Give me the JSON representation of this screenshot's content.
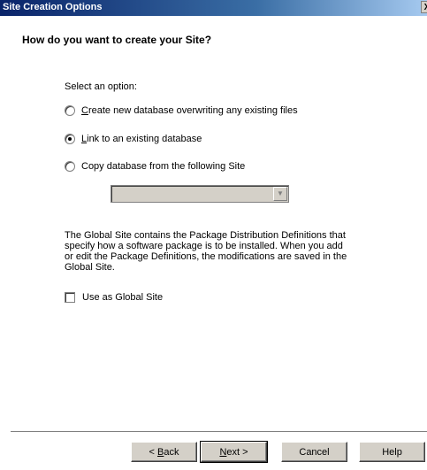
{
  "window": {
    "title": "Site Creation Options",
    "close_glyph": "X"
  },
  "heading": "How do you want to create your Site?",
  "prompt": "Select an option:",
  "options": [
    {
      "mnemonic": "C",
      "rest": "reate new database overwriting any existing files",
      "checked": false
    },
    {
      "mnemonic": "L",
      "rest": "ink to an existing database",
      "checked": true
    },
    {
      "mnemonic": "",
      "rest": "Copy database from the following Site",
      "checked": false
    }
  ],
  "site_combo": {
    "value": "",
    "arrow_icon": "chevron-down-icon"
  },
  "description": "The Global Site contains the Package Distribution Definitions that specify how a software package is to be installed. When you add or edit the Package Definitions, the modifications are saved in the Global Site.",
  "global_checkbox": {
    "label": "Use as Global Site",
    "checked": false
  },
  "buttons": {
    "back_prefix": "< ",
    "back_mnemonic": "B",
    "back_rest": "ack",
    "next_mnemonic": "N",
    "next_rest": "ext >",
    "cancel": "Cancel",
    "help": "Help"
  }
}
